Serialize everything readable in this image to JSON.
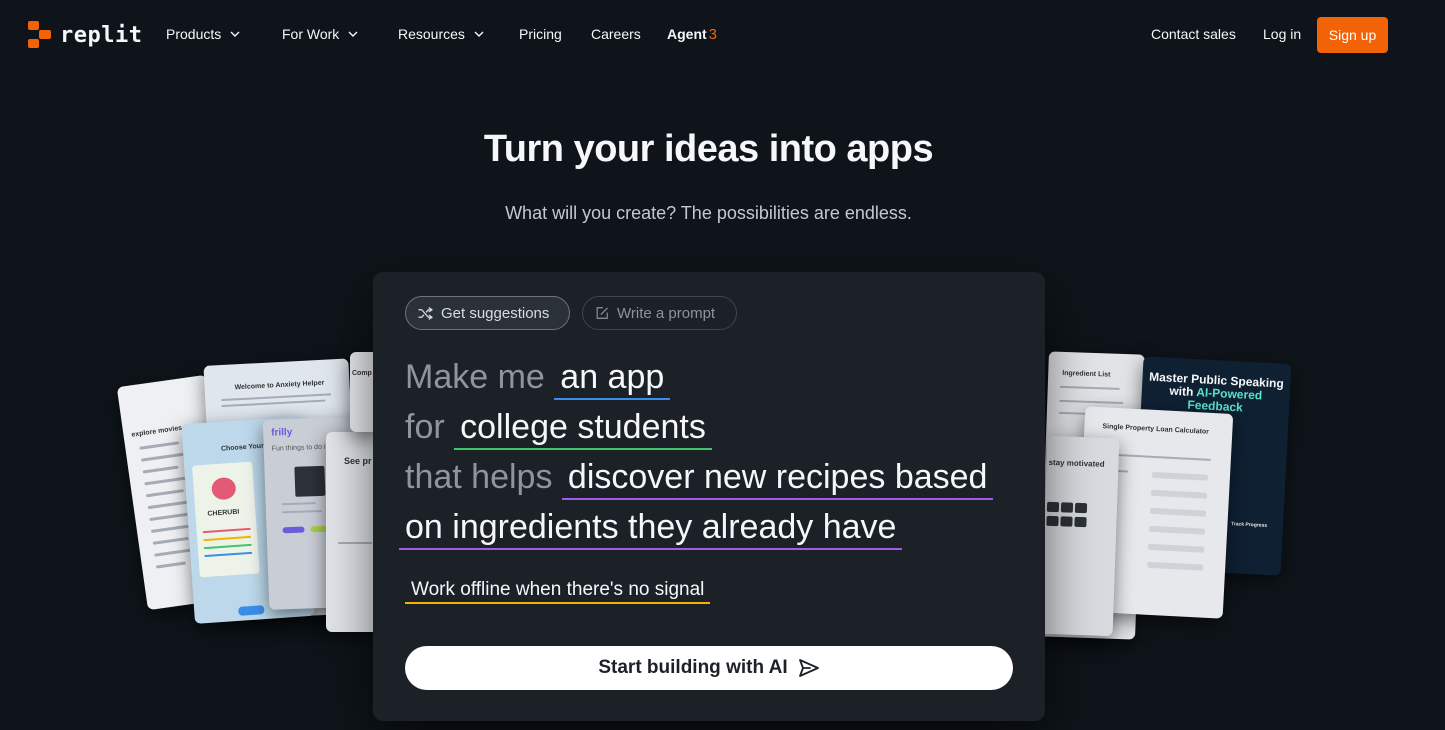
{
  "nav": {
    "logo_text": "replit",
    "items": [
      {
        "label": "Products"
      },
      {
        "label": "For Work"
      },
      {
        "label": "Resources"
      },
      {
        "label": "Pricing"
      },
      {
        "label": "Careers"
      }
    ],
    "agent_label": "Agent",
    "agent_version": "3",
    "contact_sales": "Contact sales",
    "log_in": "Log in",
    "sign_up": "Sign up"
  },
  "hero": {
    "title": "Turn your ideas into apps",
    "subtitle": "What will you create? The possibilities are endless."
  },
  "panel": {
    "get_suggestions": "Get suggestions",
    "write_prompt": "Write a prompt",
    "prompt": {
      "make_me": "Make me",
      "an_app": "an app",
      "for": "for",
      "audience": "college students",
      "that_helps": "that helps",
      "purpose_1": "discover new recipes based",
      "purpose_2": "on ingredients they already have",
      "feature": "Work offline when there's no signal"
    },
    "start_button": "Start building with AI"
  },
  "bg_cards": {
    "anxiety_title": "Welcome to Anxiety Helper",
    "explore_movies": "explore movies",
    "choose": "Choose Your P",
    "cherubi": "CHERUBI",
    "frilly": "frilly",
    "fun_things": "Fun things to do in",
    "see_pr": "See pr",
    "comp": "Comp",
    "grocery": "Ingredient List",
    "stay_motivated": "stay motivated",
    "loan_title": "Single Property Loan Calculator",
    "speaking_line1": "Master Public Speaking",
    "speaking_line2": "with",
    "speaking_highlight": "AI-Powered",
    "speaking_line3": "Feedback",
    "track_progress": "Track Progress"
  },
  "colors": {
    "brand": "#f26207",
    "underline_blue": "#3a8ee8",
    "underline_green": "#3ec76b",
    "underline_purple": "#a45be8",
    "underline_yellow": "#f2b400"
  }
}
